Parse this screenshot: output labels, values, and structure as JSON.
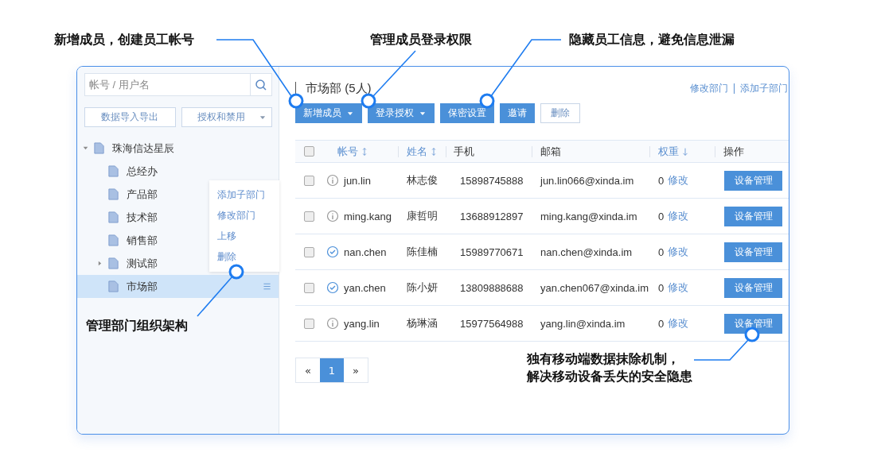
{
  "search": {
    "placeholder": "帐号 / 用户名"
  },
  "sidebar_buttons": [
    {
      "label": "数据导入导出",
      "dropdown": false
    },
    {
      "label": "授权和禁用",
      "dropdown": true
    }
  ],
  "tree": [
    {
      "label": "珠海信达星辰",
      "kind": "branch",
      "expanded": true,
      "selected": false,
      "children": [
        {
          "label": "总经办",
          "kind": "leaf",
          "selected": false
        },
        {
          "label": "产品部",
          "kind": "leaf",
          "selected": false
        },
        {
          "label": "技术部",
          "kind": "leaf",
          "selected": false
        },
        {
          "label": "销售部",
          "kind": "leaf",
          "selected": false
        },
        {
          "label": "测试部",
          "kind": "branch",
          "expanded": false,
          "selected": false
        },
        {
          "label": "市场部",
          "kind": "leaf",
          "selected": true
        }
      ]
    }
  ],
  "context_menu": {
    "items": [
      "添加子部门",
      "修改部门",
      "上移",
      "删除"
    ]
  },
  "main": {
    "title": "市场部 (5人)",
    "links": [
      "修改部门",
      "添加子部门"
    ],
    "toolbar": [
      {
        "label": "新增成员",
        "kind": "primary",
        "dropdown": true
      },
      {
        "label": "登录授权",
        "kind": "primary",
        "dropdown": true
      },
      {
        "label": "保密设置",
        "kind": "primary",
        "dropdown": false
      },
      {
        "label": "邀请",
        "kind": "primary",
        "dropdown": false
      },
      {
        "label": "删除",
        "kind": "outline",
        "dropdown": false
      }
    ]
  },
  "table": {
    "header_checked": false,
    "columns": [
      {
        "label": "帐号",
        "kind": "sortable"
      },
      {
        "label": "姓名",
        "kind": "sortable"
      },
      {
        "label": "手机",
        "kind": "plain"
      },
      {
        "label": "邮箱",
        "kind": "plain"
      },
      {
        "label": "权重",
        "kind": "sorted_desc"
      },
      {
        "label": "操作",
        "kind": "plain"
      }
    ],
    "rows": [
      {
        "checked": false,
        "kind": "info",
        "account": "jun.lin",
        "name": "林志俊",
        "phone": "15898745888",
        "email": "jun.lin066@xinda.im",
        "weight": "0",
        "edit": "修改",
        "action": "设备管理"
      },
      {
        "checked": false,
        "kind": "info",
        "account": "ming.kang",
        "name": "康哲明",
        "phone": "13688912897",
        "email": "ming.kang@xinda.im",
        "weight": "0",
        "edit": "修改",
        "action": "设备管理"
      },
      {
        "checked": false,
        "kind": "verified",
        "account": "nan.chen",
        "name": "陈佳楠",
        "phone": "15989770671",
        "email": "nan.chen@xinda.im",
        "weight": "0",
        "edit": "修改",
        "action": "设备管理"
      },
      {
        "checked": false,
        "kind": "verified",
        "account": "yan.chen",
        "name": "陈小妍",
        "phone": "13809888688",
        "email": "yan.chen067@xinda.im",
        "weight": "0",
        "edit": "修改",
        "action": "设备管理"
      },
      {
        "checked": false,
        "kind": "info",
        "account": "yang.lin",
        "name": "杨琳涵",
        "phone": "15977564988",
        "email": "yang.lin@xinda.im",
        "weight": "0",
        "edit": "修改",
        "action": "设备管理"
      }
    ]
  },
  "pagination": {
    "prev": "«",
    "pages": [
      {
        "label": "1",
        "selected": true
      }
    ],
    "next": "»"
  },
  "callouts": [
    {
      "lines": [
        "新增成员，创建员工帐号"
      ]
    },
    {
      "lines": [
        "管理成员登录权限"
      ]
    },
    {
      "lines": [
        "隐藏员工信息，避免信息泄漏"
      ]
    },
    {
      "lines": [
        "管理部门组织架构"
      ]
    },
    {
      "lines": [
        "独有移动端数据抹除机制，",
        "解决移动设备丢失的安全隐患"
      ]
    }
  ]
}
